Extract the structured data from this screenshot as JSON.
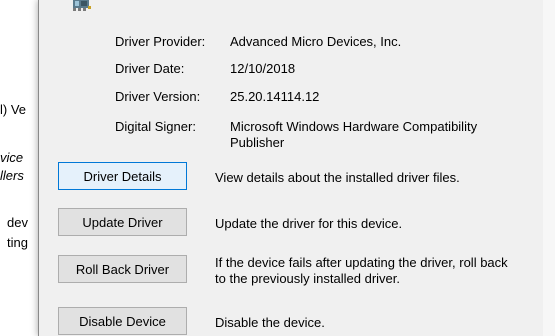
{
  "background_window": {
    "lines": [
      "l) Ve",
      "vice",
      "llers",
      "dev",
      "ting"
    ]
  },
  "dialog": {
    "icon": "device-chip-icon",
    "info": [
      {
        "label": "Driver Provider:",
        "value": "Advanced Micro Devices, Inc."
      },
      {
        "label": "Driver Date:",
        "value": "12/10/2018"
      },
      {
        "label": "Driver Version:",
        "value": "25.20.14114.12"
      },
      {
        "label": "Digital Signer:",
        "value": "Microsoft Windows Hardware Compatibility Publisher"
      }
    ],
    "actions": [
      {
        "button": "Driver Details",
        "description": "View details about the installed driver files."
      },
      {
        "button": "Update Driver",
        "description": "Update the driver for this device."
      },
      {
        "button": "Roll Back Driver",
        "description": "If the device fails after updating the driver, roll back to the previously installed driver."
      },
      {
        "button": "Disable Device",
        "description": "Disable the device."
      }
    ]
  },
  "colors": {
    "dialog_bg": "#f0f0f0",
    "button_bg": "#e1e1e1",
    "button_border": "#adadad",
    "focus_bg": "#e5f1fb",
    "focus_border": "#0078d7"
  }
}
